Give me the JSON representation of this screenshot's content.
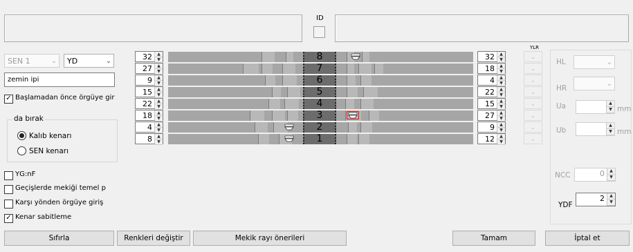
{
  "top": {
    "id_label": "ID"
  },
  "left": {
    "sen_value": "SEN 1",
    "yd_value": "YD",
    "name_value": "zemin ipi",
    "check_start": "Başlamadan önce örgüye gir",
    "group_title": "da bırak",
    "radio_kalip": "Kalıb kenarı",
    "radio_sen": "SEN kenarı",
    "check_ygnf": "YG:nF",
    "check_gecis": "Geçişlerde mekiği temel p",
    "check_karsi": "Karşı yönden örgüye giriş",
    "check_kenar": "Kenar sabitleme"
  },
  "rows": [
    {
      "num": "8",
      "left": "32",
      "right": "32",
      "marker": "right"
    },
    {
      "num": "7",
      "left": "27",
      "right": "18",
      "marker": ""
    },
    {
      "num": "6",
      "left": "9",
      "right": "4",
      "marker": ""
    },
    {
      "num": "5",
      "left": "15",
      "right": "22",
      "marker": ""
    },
    {
      "num": "4",
      "left": "22",
      "right": "15",
      "marker": ""
    },
    {
      "num": "3",
      "left": "18",
      "right": "27",
      "marker": "right-selected"
    },
    {
      "num": "2",
      "left": "4",
      "right": "9",
      "marker": "left"
    },
    {
      "num": "1",
      "left": "8",
      "right": "12",
      "marker": "left"
    }
  ],
  "ylr_label": "YLR",
  "right_panel": {
    "hl": "HL",
    "hr": "HR",
    "ua": "Ua",
    "ub": "Ub",
    "mm": "mm",
    "ncc": "NCC",
    "ncc_value": "0",
    "ydf": "YDF",
    "ydf_value": "2"
  },
  "buttons": {
    "sifirla": "Sıfırla",
    "renkler": "Renkleri değiştir",
    "mekik": "Mekik rayı önerileri",
    "tamam": "Tamam",
    "iptal": "İptal et"
  }
}
